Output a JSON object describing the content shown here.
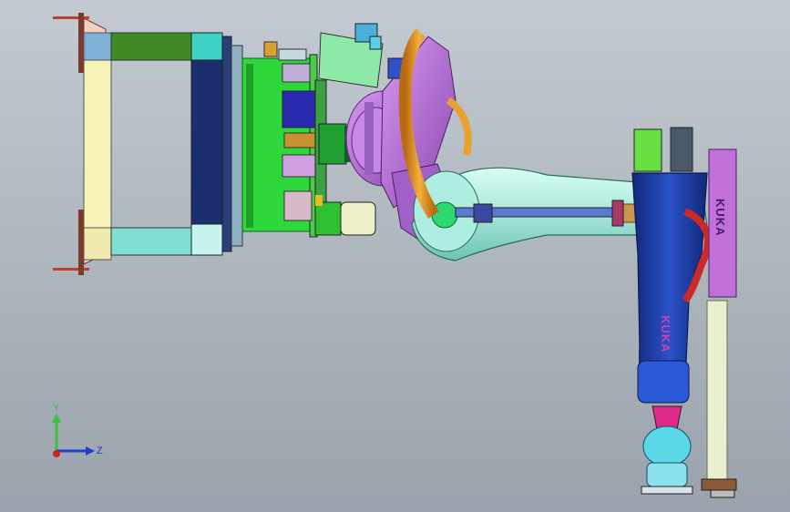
{
  "viewport": {
    "background_top": "#c3cad1",
    "background_bottom": "#9aa2ab"
  },
  "robot": {
    "brand_arm": "KUKA",
    "brand_base": "KUKA",
    "colors": {
      "lower_arm": "#1a3a9c",
      "upper_arm": "#bfeee0",
      "wrist": "#b070d8",
      "base_violet": "#b070d8",
      "dress_pack": "#e8901a",
      "cable_red": "#cc2a2a",
      "counterbalance": "#e8f0d0"
    }
  },
  "gripper": {
    "frame_colors": {
      "cream": "#f5f0b0",
      "navy": "#1b2f6e",
      "olive": "#3f8a22",
      "green": "#2ed83a",
      "teal": "#4fd8c8"
    }
  },
  "triad": {
    "y_label": "Y",
    "z_label": "Z",
    "y_color": "#3fbf3f",
    "z_color": "#1f3fcf",
    "x_color": "#d02020"
  }
}
